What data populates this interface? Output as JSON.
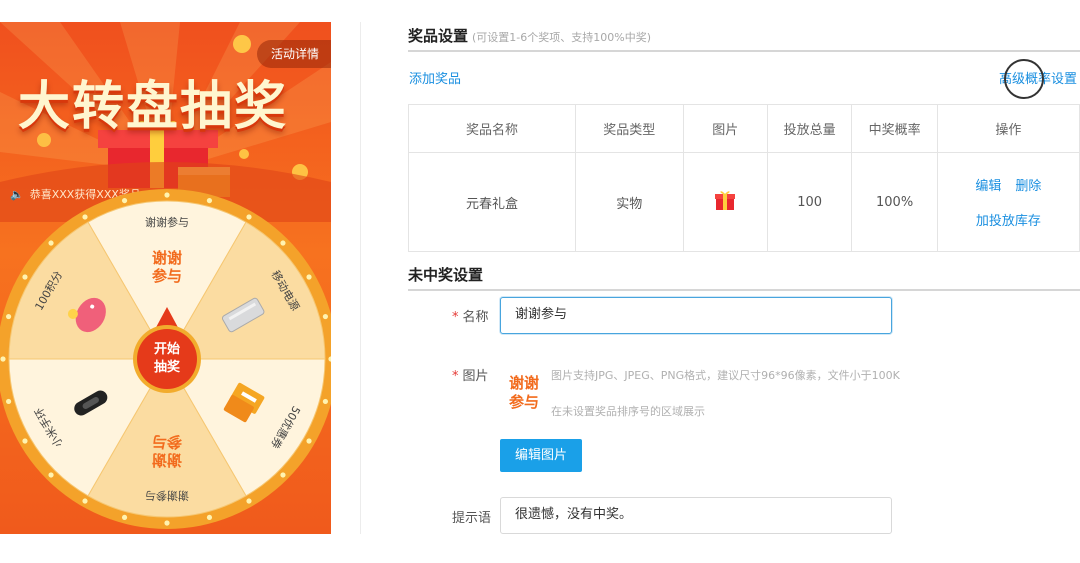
{
  "promo": {
    "title": "大转盘抽奖",
    "activity_details": "活动详情",
    "notice": "恭喜XXX获得XXX奖品",
    "spin_button": [
      "开始",
      "抽奖"
    ],
    "wheel": {
      "segments": [
        {
          "label": "谢谢参与",
          "art": "谢谢参与",
          "icon": "thanks-text-icon"
        },
        {
          "label": "移动电源",
          "icon": "power-bank-icon"
        },
        {
          "label": "50优惠券",
          "icon": "coupon-icon"
        },
        {
          "label": "谢谢参与",
          "art": "谢谢参与",
          "icon": "thanks-text-icon"
        },
        {
          "label": "小米手环",
          "icon": "wristband-icon"
        },
        {
          "label": "100积分",
          "icon": "piggy-bank-icon"
        }
      ],
      "colors": {
        "light": "#fff4dd",
        "dark": "#fbdca1",
        "rim": "#f4a22a",
        "hub": "#e53a1a"
      }
    }
  },
  "prize_settings": {
    "title": "奖品设置",
    "subtitle": "(可设置1-6个奖项、支持100%中奖)",
    "add_link": "添加奖品",
    "advanced_link": "高级概率设置",
    "table": {
      "headers": [
        "奖品名称",
        "奖品类型",
        "图片",
        "投放总量",
        "中奖概率",
        "操作"
      ],
      "rows": [
        {
          "name": "元春礼盒",
          "type": "实物",
          "image_icon": "gift-box-icon",
          "quantity": "100",
          "probability": "100%",
          "actions": {
            "edit": "编辑",
            "delete": "删除",
            "add_stock": "加投放库存"
          }
        }
      ]
    }
  },
  "no_win_settings": {
    "title": "未中奖设置",
    "name_label": "名称",
    "name_value": "谢谢参与",
    "image_label": "图片",
    "image_art": "谢谢参与",
    "image_hint_1": "图片支持JPG、JPEG、PNG格式，建议尺寸96*96像素，文件小于100K",
    "image_hint_2": "在未设置奖品排序号的区域展示",
    "edit_image_button": "编辑图片",
    "tip_label": "提示语",
    "tip_value": "很遗憾，没有中奖。"
  },
  "colors": {
    "accent": "#1a8fe0",
    "button": "#1aa0e8",
    "promo_orange": "#f05a1c"
  }
}
